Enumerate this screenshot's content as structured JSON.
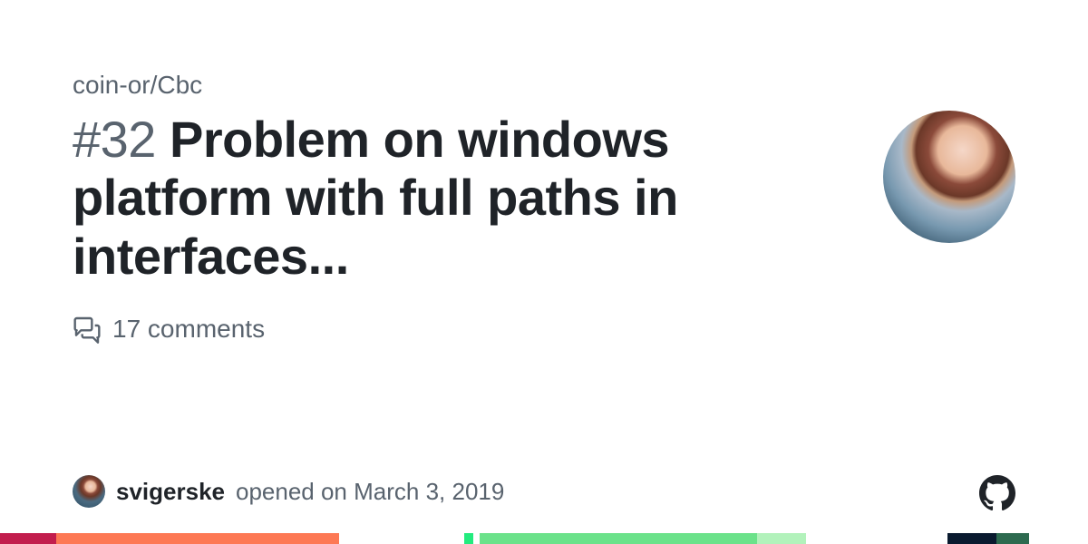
{
  "repo": "coin-or/Cbc",
  "issue": {
    "number": "#32",
    "title": "Problem on windows platform with full paths in interfaces...",
    "comments_count": "17 comments"
  },
  "author": {
    "username": "svigerske",
    "action": "opened on March 3, 2019"
  },
  "icons": {
    "comment": "comment-discussion-icon",
    "github": "github-mark-icon"
  },
  "color_bar": [
    {
      "color": "#c21d4d",
      "width": "5.2%"
    },
    {
      "color": "#fd7854",
      "width": "26%"
    },
    {
      "color": "#ffffff",
      "width": "11.5%"
    },
    {
      "color": "#23eb7e",
      "width": "0.8%"
    },
    {
      "color": "#ffffff",
      "width": "0.6%"
    },
    {
      "color": "#6be28a",
      "width": "25.5%"
    },
    {
      "color": "#b2f2bb",
      "width": "4.5%"
    },
    {
      "color": "#ffffff",
      "width": "13%"
    },
    {
      "color": "#0a1a2f",
      "width": "4.5%"
    },
    {
      "color": "#2d6a4f",
      "width": "3%"
    },
    {
      "color": "#ffffff",
      "width": "5.4%"
    }
  ]
}
